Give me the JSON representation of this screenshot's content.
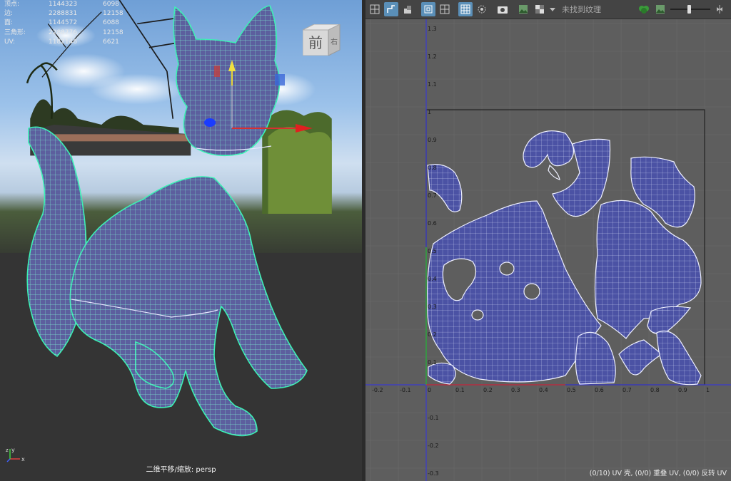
{
  "viewport": {
    "hud": [
      {
        "label": "顶点:",
        "v1": "1144323",
        "v2": "6098"
      },
      {
        "label": "边:",
        "v1": "2288831",
        "v2": "12158"
      },
      {
        "label": "面:",
        "v1": "1144572",
        "v2": "6088"
      },
      {
        "label": "三角形:",
        "v1": "2288776",
        "v2": "12158"
      },
      {
        "label": "UV:",
        "v1": "1182146",
        "v2": "6621"
      }
    ],
    "view_cube_front": "前",
    "view_cube_right": "右",
    "caption": "二维平移/缩放: persp",
    "axis_labels": {
      "x": "x",
      "y": "y",
      "z": "z"
    }
  },
  "uv_editor": {
    "toolbar_texture_label": "未找到纹理",
    "toolbar_icons": [
      "uv-shell-icon",
      "uv-select-icon",
      "uv-shade-icon",
      "wireframe-icon",
      "grid-icon",
      "checker-grid-icon",
      "texture-borders-icon",
      "snapshot-icon",
      "image-icon",
      "checker-icon",
      "dropdown-icon",
      "rgb-icon",
      "image-display-icon",
      "exposure-slider",
      "gamma-icon"
    ],
    "ticks_u": [
      "-0.2",
      "-0.1",
      "0",
      "0.1",
      "0.2",
      "0.3",
      "0.4",
      "0.5",
      "0.6",
      "0.7",
      "0.8",
      "0.9",
      "1"
    ],
    "ticks_v": [
      "1.3",
      "1.2",
      "1.1",
      "1",
      "0.9",
      "0.8",
      "0.7",
      "0.6",
      "0.5",
      "0.4",
      "0.3",
      "0.2",
      "0.1",
      "0",
      "-0.1",
      "-0.2",
      "-0.3"
    ],
    "status": "(0/10) UV 壳, (0/0) 重叠 UV, (0/0) 反转 UV",
    "colors": {
      "shell_fill": "#4b52a4",
      "shell_line": "#dfe4ff",
      "bg": "#5e5e5e",
      "grid": "#676767"
    }
  }
}
